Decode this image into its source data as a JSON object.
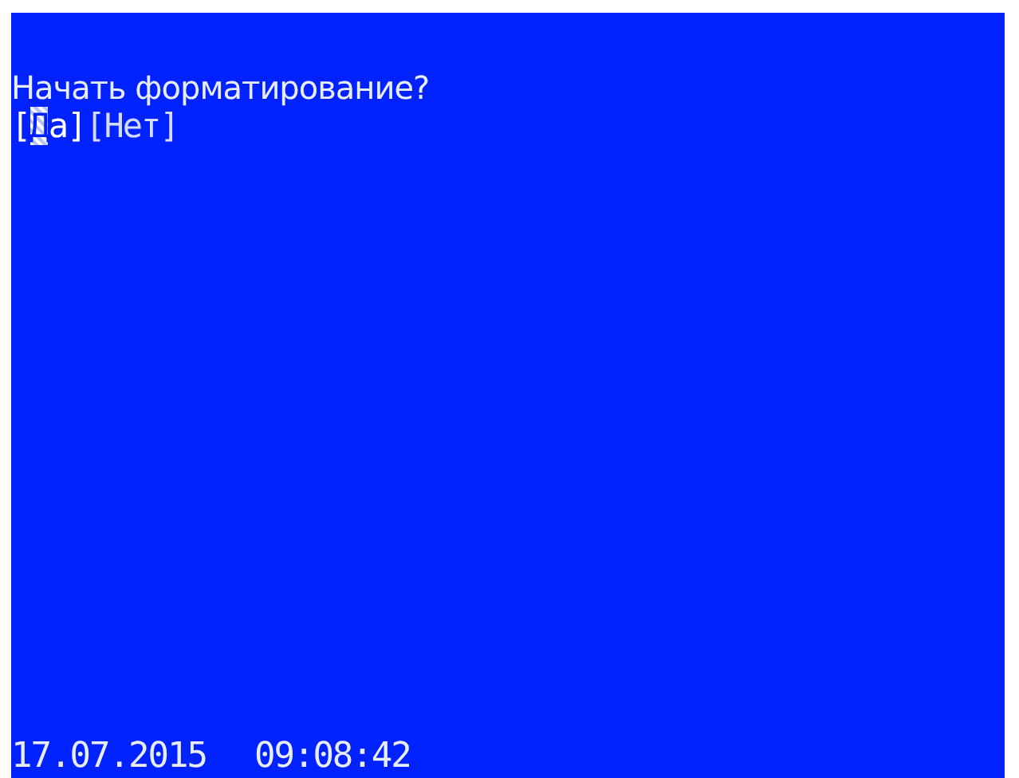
{
  "prompt": "Начать форматирование?",
  "options": [
    {
      "label": "[Да]",
      "selected": true
    },
    {
      "label": "[Нет]",
      "selected": false
    }
  ],
  "status_bar": {
    "date": "17.07.2015",
    "time": "09:08:42"
  }
}
